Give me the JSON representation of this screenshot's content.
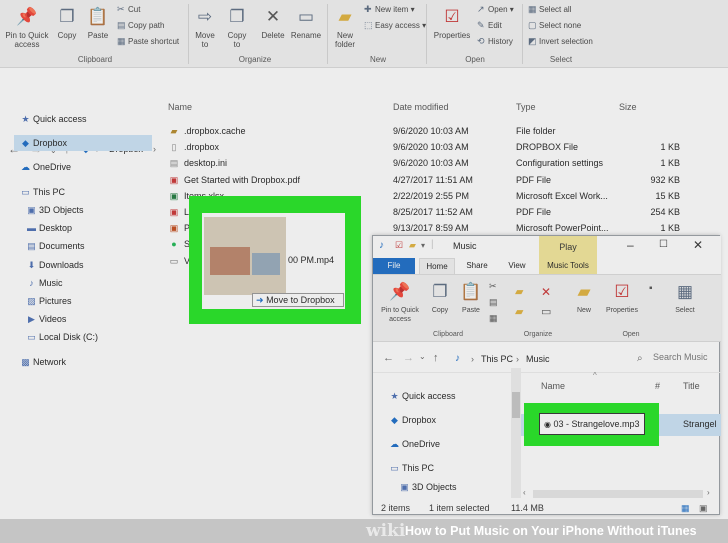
{
  "ribbon": {
    "pin_quick_access": "Pin to Quick\naccess",
    "copy": "Copy",
    "paste": "Paste",
    "cut": "Cut",
    "copy_path": "Copy path",
    "paste_shortcut": "Paste shortcut",
    "move_to": "Move\nto",
    "copy_to": "Copy\nto",
    "delete": "Delete",
    "rename": "Rename",
    "new_folder": "New\nfolder",
    "new_item": "New item",
    "easy_access": "Easy access",
    "properties": "Properties",
    "open": "Open",
    "edit": "Edit",
    "history": "History",
    "select_all": "Select all",
    "select_none": "Select none",
    "invert_selection": "Invert selection",
    "groups": {
      "clipboard": "Clipboard",
      "organize": "Organize",
      "new": "New",
      "open": "Open",
      "select": "Select"
    }
  },
  "address": {
    "location": "Dropbox"
  },
  "sidebar": {
    "items": [
      {
        "label": "Quick access",
        "icon": "star-icon"
      },
      {
        "label": "Dropbox",
        "icon": "dropbox-icon"
      },
      {
        "label": "OneDrive",
        "icon": "cloud-icon"
      },
      {
        "label": "This PC",
        "icon": "computer-icon"
      },
      {
        "label": "3D Objects",
        "icon": "cube-icon"
      },
      {
        "label": "Desktop",
        "icon": "desktop-icon"
      },
      {
        "label": "Documents",
        "icon": "documents-icon"
      },
      {
        "label": "Downloads",
        "icon": "download-icon"
      },
      {
        "label": "Music",
        "icon": "music-icon"
      },
      {
        "label": "Pictures",
        "icon": "pictures-icon"
      },
      {
        "label": "Videos",
        "icon": "videos-icon"
      },
      {
        "label": "Local Disk (C:)",
        "icon": "disk-icon"
      },
      {
        "label": "Network",
        "icon": "network-icon"
      }
    ]
  },
  "columns": {
    "name": "Name",
    "date": "Date modified",
    "type": "Type",
    "size": "Size"
  },
  "files": [
    {
      "name": ".dropbox.cache",
      "date": "9/6/2020 10:03 AM",
      "type": "File folder",
      "size": ""
    },
    {
      "name": ".dropbox",
      "date": "9/6/2020 10:03 AM",
      "type": "DROPBOX File",
      "size": "1 KB"
    },
    {
      "name": "desktop.ini",
      "date": "9/6/2020 10:03 AM",
      "type": "Configuration settings",
      "size": "1 KB"
    },
    {
      "name": "Get Started with Dropbox.pdf",
      "date": "4/27/2017 11:51 AM",
      "type": "PDF File",
      "size": "932 KB"
    },
    {
      "name": "Items.xlsx",
      "date": "2/22/2019 2:55 PM",
      "type": "Microsoft Excel Work...",
      "size": "15 KB"
    },
    {
      "name": "Lo",
      "date": "8/25/2017 11:52 AM",
      "type": "PDF File",
      "size": "254 KB"
    },
    {
      "name": "Pr",
      "date": "9/13/2017 8:59 AM",
      "type": "Microsoft PowerPoint...",
      "size": "1 KB"
    },
    {
      "name": "Sp",
      "date": "",
      "type": "",
      "size": ""
    },
    {
      "name": "Vi",
      "date": "",
      "type": "",
      "size": ""
    }
  ],
  "drag": {
    "video_name": "00 PM.mp4",
    "tooltip": "Move to Dropbox"
  },
  "music_window": {
    "title": "Music",
    "play_tab": "Play",
    "tabs": {
      "file": "File",
      "home": "Home",
      "share": "Share",
      "view": "View",
      "music_tools": "Music Tools"
    },
    "ribbon": {
      "pin": "Pin to Quick\naccess",
      "copy": "Copy",
      "paste": "Paste",
      "new": "New",
      "properties": "Properties",
      "select": "Select",
      "groups": {
        "clipboard": "Clipboard",
        "organize": "Organize",
        "open": "Open"
      }
    },
    "address": {
      "this_pc": "This PC",
      "music": "Music"
    },
    "search_placeholder": "Search Music",
    "columns": {
      "name": "Name",
      "num": "#",
      "title": "Title"
    },
    "nav": [
      "Quick access",
      "Dropbox",
      "OneDrive",
      "This PC",
      "3D Objects"
    ],
    "selected_file": "03 - Strangelove.mp3",
    "file_title": "Strangel",
    "status": {
      "items": "2 items",
      "selected": "1 item selected",
      "size": "11.4 MB"
    }
  },
  "banner": {
    "wiki": "wiki",
    "title": "How to Put Music on Your iPhone Without iTunes"
  },
  "colors": {
    "highlight_green": "#22e621",
    "selection_blue": "#cce4f7",
    "play_tab": "#f4e89a",
    "file_tab": "#1a6dc9"
  }
}
